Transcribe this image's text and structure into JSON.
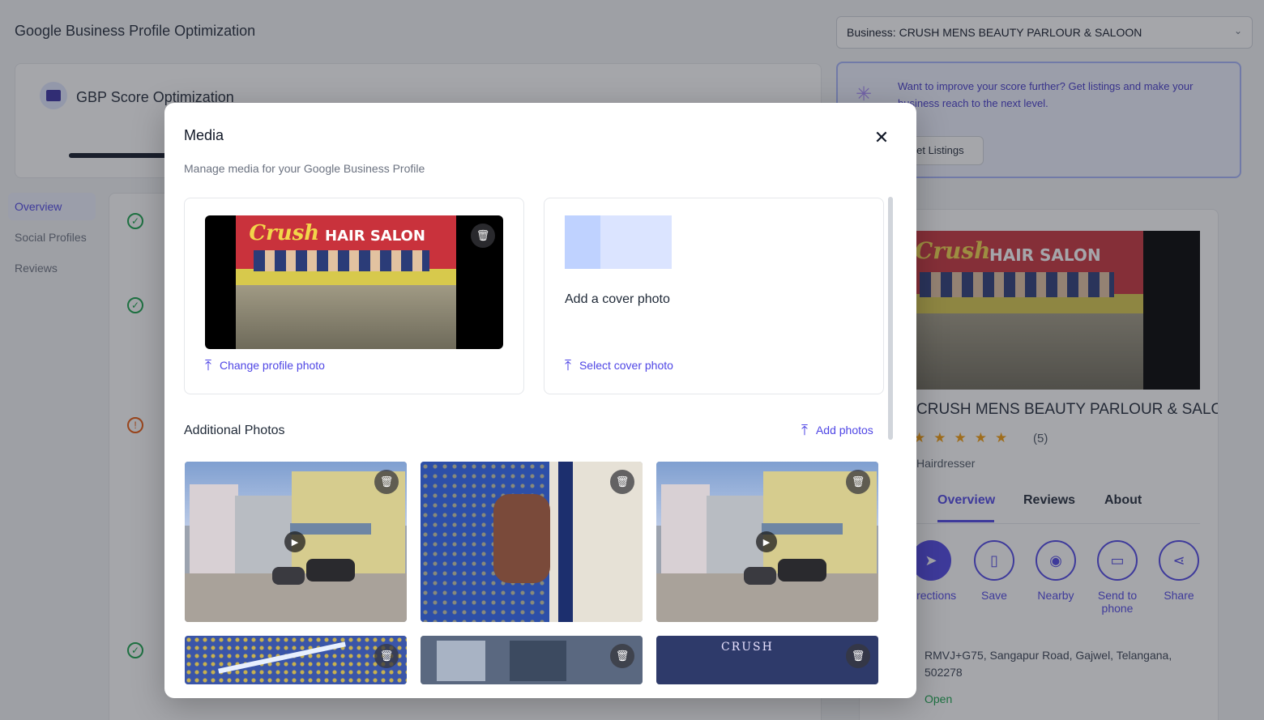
{
  "page": {
    "title": "Google Business Profile Optimization",
    "business_select": "Business: CRUSH MENS BEAUTY PARLOUR & SALOON",
    "score_card_title": "GBP Score Optimization"
  },
  "promo": {
    "text": "Want to improve your score further? Get listings and make your business reach to the next level.",
    "button": "Get Listings"
  },
  "sidebar": {
    "items": [
      {
        "label": "Overview"
      },
      {
        "label": "Social Profiles"
      },
      {
        "label": "Reviews"
      }
    ]
  },
  "preview": {
    "sign_text": "HAIR SALON",
    "sign_script": "Crush",
    "name": "CRUSH MENS BEAUTY PARLOUR & SALOON",
    "stars": "★★★★★",
    "rating_count": "(5)",
    "category": "Hairdresser",
    "tabs": [
      "Overview",
      "Reviews",
      "About"
    ],
    "actions": [
      {
        "label": "Directions",
        "icon": "directions-icon"
      },
      {
        "label": "Save",
        "icon": "bookmark-icon"
      },
      {
        "label": "Nearby",
        "icon": "nearby-icon"
      },
      {
        "label": "Send to phone",
        "icon": "phone-icon"
      },
      {
        "label": "Share",
        "icon": "share-icon"
      }
    ],
    "address": "RMVJ+G75, Sangapur Road, Gajwel, Telangana, 502278",
    "open_status": "Open"
  },
  "modal": {
    "title": "Media",
    "subtitle": "Manage media for your Google Business Profile",
    "profile": {
      "sign_text": "HAIR SALON",
      "sign_script": "Crush",
      "change_label": "Change profile photo"
    },
    "cover": {
      "prompt": "Add a cover photo",
      "select_label": "Select cover photo"
    },
    "additional": {
      "title": "Additional Photos",
      "add_label": "Add photos",
      "crush_sign": "CRUSH"
    }
  }
}
